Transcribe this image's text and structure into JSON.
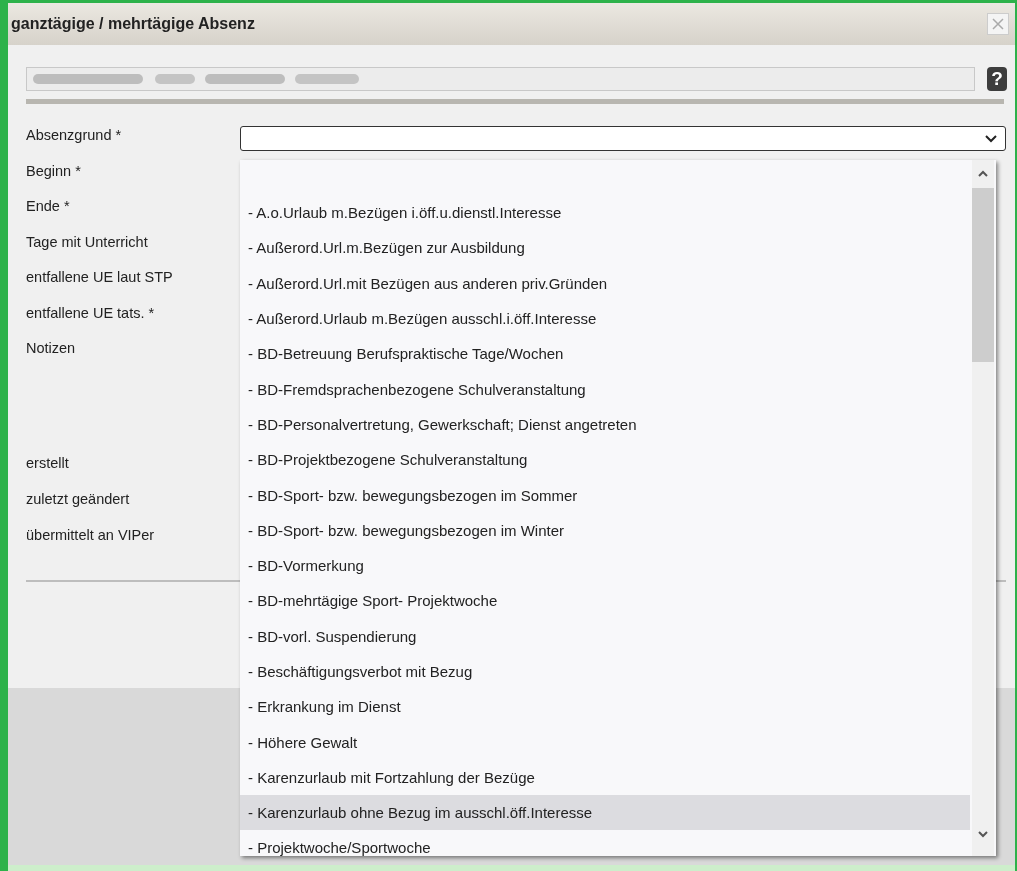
{
  "dialog": {
    "title": "ganztägige / mehrtägige Absenz",
    "help_label": "?"
  },
  "labels": [
    {
      "text": "Absenzgrund *",
      "kind": "field"
    },
    {
      "text": "Beginn *",
      "kind": "field"
    },
    {
      "text": "Ende *",
      "kind": "field"
    },
    {
      "text": "Tage mit Unterricht",
      "kind": "field"
    },
    {
      "text": "entfallene UE laut STP",
      "kind": "field"
    },
    {
      "text": "entfallene UE tats. *",
      "kind": "field"
    },
    {
      "text": "Notizen",
      "kind": "notes"
    },
    {
      "text": "erstellt",
      "kind": "field"
    },
    {
      "text": "zuletzt geändert",
      "kind": "field"
    },
    {
      "text": "übermittelt an VIPer",
      "kind": "field"
    }
  ],
  "dropdown": {
    "expanded": true,
    "options": [
      {
        "text": "- A.o.Urlaub m.Bezügen i.öff.u.dienstl.Interesse",
        "selected": false
      },
      {
        "text": "- Außerord.Url.m.Bezügen zur Ausbildung",
        "selected": false
      },
      {
        "text": "- Außerord.Url.mit Bezügen aus anderen priv.Gründen",
        "selected": false
      },
      {
        "text": "- Außerord.Urlaub m.Bezügen ausschl.i.öff.Interesse",
        "selected": false
      },
      {
        "text": "- BD-Betreuung Berufspraktische Tage/Wochen",
        "selected": false
      },
      {
        "text": "- BD-Fremdsprachenbezogene Schulveranstaltung",
        "selected": false
      },
      {
        "text": "- BD-Personalvertretung, Gewerkschaft; Dienst angetreten",
        "selected": false
      },
      {
        "text": "- BD-Projektbezogene Schulveranstaltung",
        "selected": false
      },
      {
        "text": "- BD-Sport- bzw. bewegungsbezogen im Sommer",
        "selected": false
      },
      {
        "text": "- BD-Sport- bzw. bewegungsbezogen im Winter",
        "selected": false
      },
      {
        "text": "- BD-Vormerkung",
        "selected": false
      },
      {
        "text": "- BD-mehrtägige Sport- Projektwoche",
        "selected": false
      },
      {
        "text": "- BD-vorl. Suspendierung",
        "selected": false
      },
      {
        "text": "- Beschäftigungsverbot mit Bezug",
        "selected": false
      },
      {
        "text": "- Erkrankung im Dienst",
        "selected": false
      },
      {
        "text": "- Höhere Gewalt",
        "selected": false
      },
      {
        "text": "- Karenzurlaub mit Fortzahlung der Bezüge",
        "selected": false
      },
      {
        "text": "- Karenzurlaub ohne Bezug im ausschl.öff.Interesse",
        "selected": true
      },
      {
        "text": "- Projektwoche/Sportwoche",
        "selected": false
      }
    ]
  }
}
